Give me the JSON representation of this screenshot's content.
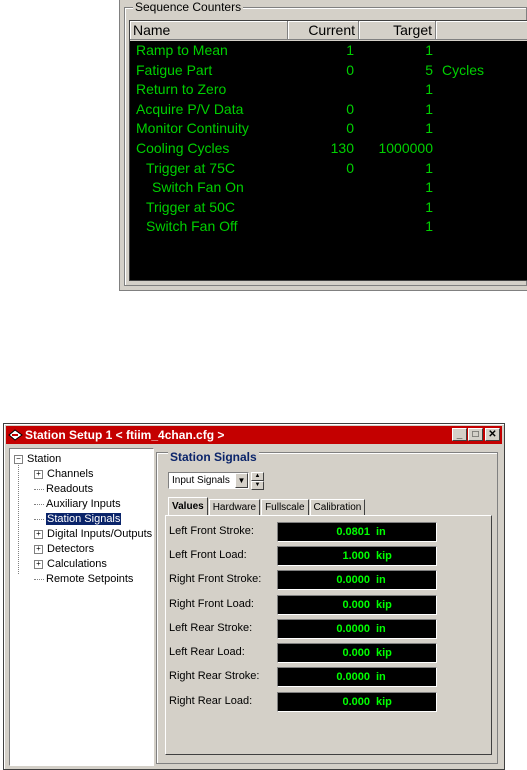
{
  "sequence_counters": {
    "title": "Sequence Counters",
    "headers": {
      "name": "Name",
      "current": "Current",
      "target": "Target",
      "unit": ""
    },
    "rows": [
      {
        "name": "Ramp to Mean",
        "current": "1",
        "target": "1",
        "unit": ""
      },
      {
        "name": "Fatigue Part",
        "current": "0",
        "target": "5",
        "unit": "Cycles"
      },
      {
        "name": "Return to Zero",
        "current": "",
        "target": "1",
        "unit": ""
      },
      {
        "name": "Acquire P/V Data",
        "current": "0",
        "target": "1",
        "unit": ""
      },
      {
        "name": "Monitor Continuity",
        "current": "0",
        "target": "1",
        "unit": ""
      },
      {
        "name": "Cooling Cycles",
        "current": "130",
        "target": "1000000",
        "unit": ""
      },
      {
        "name": "Trigger at 75C",
        "current": "0",
        "target": "1",
        "unit": ""
      },
      {
        "name": "Switch Fan On",
        "current": "",
        "target": "1",
        "unit": ""
      },
      {
        "name": "Trigger at 50C",
        "current": "",
        "target": "1",
        "unit": ""
      },
      {
        "name": "Switch Fan Off",
        "current": "",
        "target": "1",
        "unit": ""
      }
    ]
  },
  "station_window": {
    "title": "Station Setup 1 < ftiim_4chan.cfg >",
    "buttons": {
      "minimize": "_",
      "maximize": "□",
      "close": "✕"
    },
    "tree": {
      "root": "Station",
      "items": [
        {
          "label": "Channels",
          "expandable": true
        },
        {
          "label": "Readouts",
          "expandable": false
        },
        {
          "label": "Auxiliary Inputs",
          "expandable": false
        },
        {
          "label": "Station Signals",
          "expandable": false,
          "selected": true
        },
        {
          "label": "Digital Inputs/Outputs",
          "expandable": true
        },
        {
          "label": "Detectors",
          "expandable": true
        },
        {
          "label": "Calculations",
          "expandable": true
        },
        {
          "label": "Remote Setpoints",
          "expandable": false
        }
      ]
    },
    "panel": {
      "title": "Station Signals",
      "select_value": "Input Signals",
      "tabs": [
        "Values",
        "Hardware",
        "Fullscale",
        "Calibration"
      ],
      "active_tab": "Values",
      "signals": [
        {
          "label": "Left Front Stroke:",
          "value": "0.0801",
          "unit": "in"
        },
        {
          "label": "Left Front Load:",
          "value": "1.000",
          "unit": "kip"
        },
        {
          "label": "Right Front Stroke:",
          "value": "0.0000",
          "unit": "in"
        },
        {
          "label": "Right Front Load:",
          "value": "0.000",
          "unit": "kip"
        },
        {
          "label": "Left Rear Stroke:",
          "value": "0.0000",
          "unit": "in"
        },
        {
          "label": "Left Rear Load:",
          "value": "0.000",
          "unit": "kip"
        },
        {
          "label": "Right Rear Stroke:",
          "value": "0.0000",
          "unit": "in"
        },
        {
          "label": "Right Rear Load:",
          "value": "0.000",
          "unit": "kip"
        }
      ]
    }
  },
  "colors": {
    "counter_text": "#00d000",
    "signal_text": "#00ff00",
    "titlebar": "#c40000",
    "panel_title": "#0a246a"
  }
}
